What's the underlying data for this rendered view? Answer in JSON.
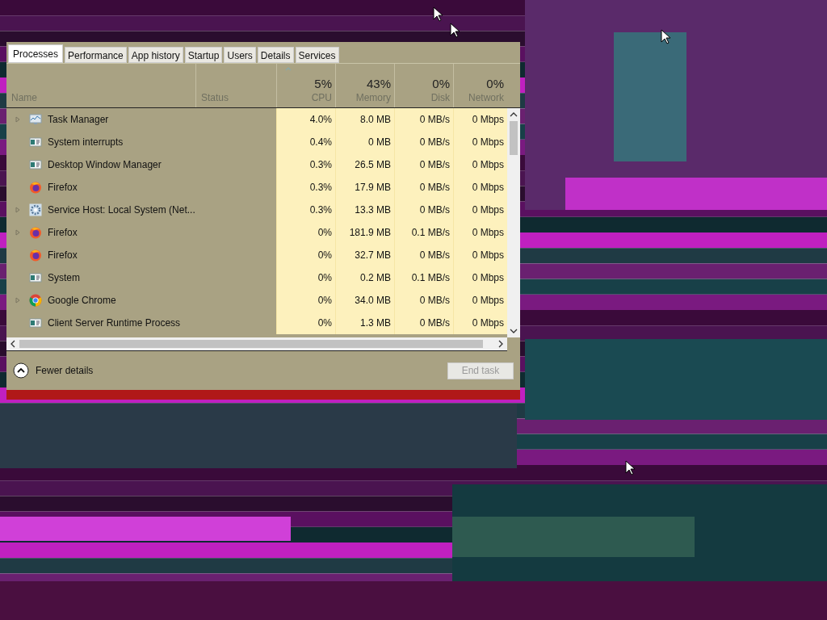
{
  "tabs": [
    {
      "label": "Processes",
      "selected": true
    },
    {
      "label": "Performance",
      "selected": false
    },
    {
      "label": "App history",
      "selected": false
    },
    {
      "label": "Startup",
      "selected": false
    },
    {
      "label": "Users",
      "selected": false
    },
    {
      "label": "Details",
      "selected": false
    },
    {
      "label": "Services",
      "selected": false
    }
  ],
  "columns": [
    {
      "label": "Name"
    },
    {
      "label": "Status"
    },
    {
      "percent": "5%",
      "label": "CPU"
    },
    {
      "percent": "43%",
      "label": "Memory"
    },
    {
      "percent": "0%",
      "label": "Disk"
    },
    {
      "percent": "0%",
      "label": "Network"
    }
  ],
  "rows": [
    {
      "name": "Task Manager",
      "kind": "taskmgr",
      "expandable": true,
      "cpu": "4.0%",
      "memory": "8.0 MB",
      "disk": "0 MB/s",
      "network": "0 Mbps"
    },
    {
      "name": "System interrupts",
      "kind": "window",
      "expandable": false,
      "cpu": "0.4%",
      "memory": "0 MB",
      "disk": "0 MB/s",
      "network": "0 Mbps"
    },
    {
      "name": "Desktop Window Manager",
      "kind": "window",
      "expandable": false,
      "cpu": "0.3%",
      "memory": "26.5 MB",
      "disk": "0 MB/s",
      "network": "0 Mbps"
    },
    {
      "name": "Firefox",
      "kind": "firefox",
      "expandable": false,
      "cpu": "0.3%",
      "memory": "17.9 MB",
      "disk": "0 MB/s",
      "network": "0 Mbps"
    },
    {
      "name": "Service Host: Local System (Net...",
      "kind": "gear",
      "expandable": true,
      "cpu": "0.3%",
      "memory": "13.3 MB",
      "disk": "0 MB/s",
      "network": "0 Mbps"
    },
    {
      "name": "Firefox",
      "kind": "firefox",
      "expandable": true,
      "cpu": "0%",
      "memory": "181.9 MB",
      "disk": "0.1 MB/s",
      "network": "0 Mbps"
    },
    {
      "name": "Firefox",
      "kind": "firefox",
      "expandable": false,
      "cpu": "0%",
      "memory": "32.7 MB",
      "disk": "0 MB/s",
      "network": "0 Mbps"
    },
    {
      "name": "System",
      "kind": "window",
      "expandable": false,
      "cpu": "0%",
      "memory": "0.2 MB",
      "disk": "0.1 MB/s",
      "network": "0 Mbps"
    },
    {
      "name": "Google Chrome",
      "kind": "chrome",
      "expandable": true,
      "cpu": "0%",
      "memory": "34.0 MB",
      "disk": "0 MB/s",
      "network": "0 Mbps"
    },
    {
      "name": "Client Server Runtime Process",
      "kind": "window",
      "expandable": false,
      "cpu": "0%",
      "memory": "1.3 MB",
      "disk": "0 MB/s",
      "network": "0 Mbps"
    }
  ],
  "footer": {
    "toggle": "Fewer details",
    "button": "End task",
    "button_disabled": true
  }
}
